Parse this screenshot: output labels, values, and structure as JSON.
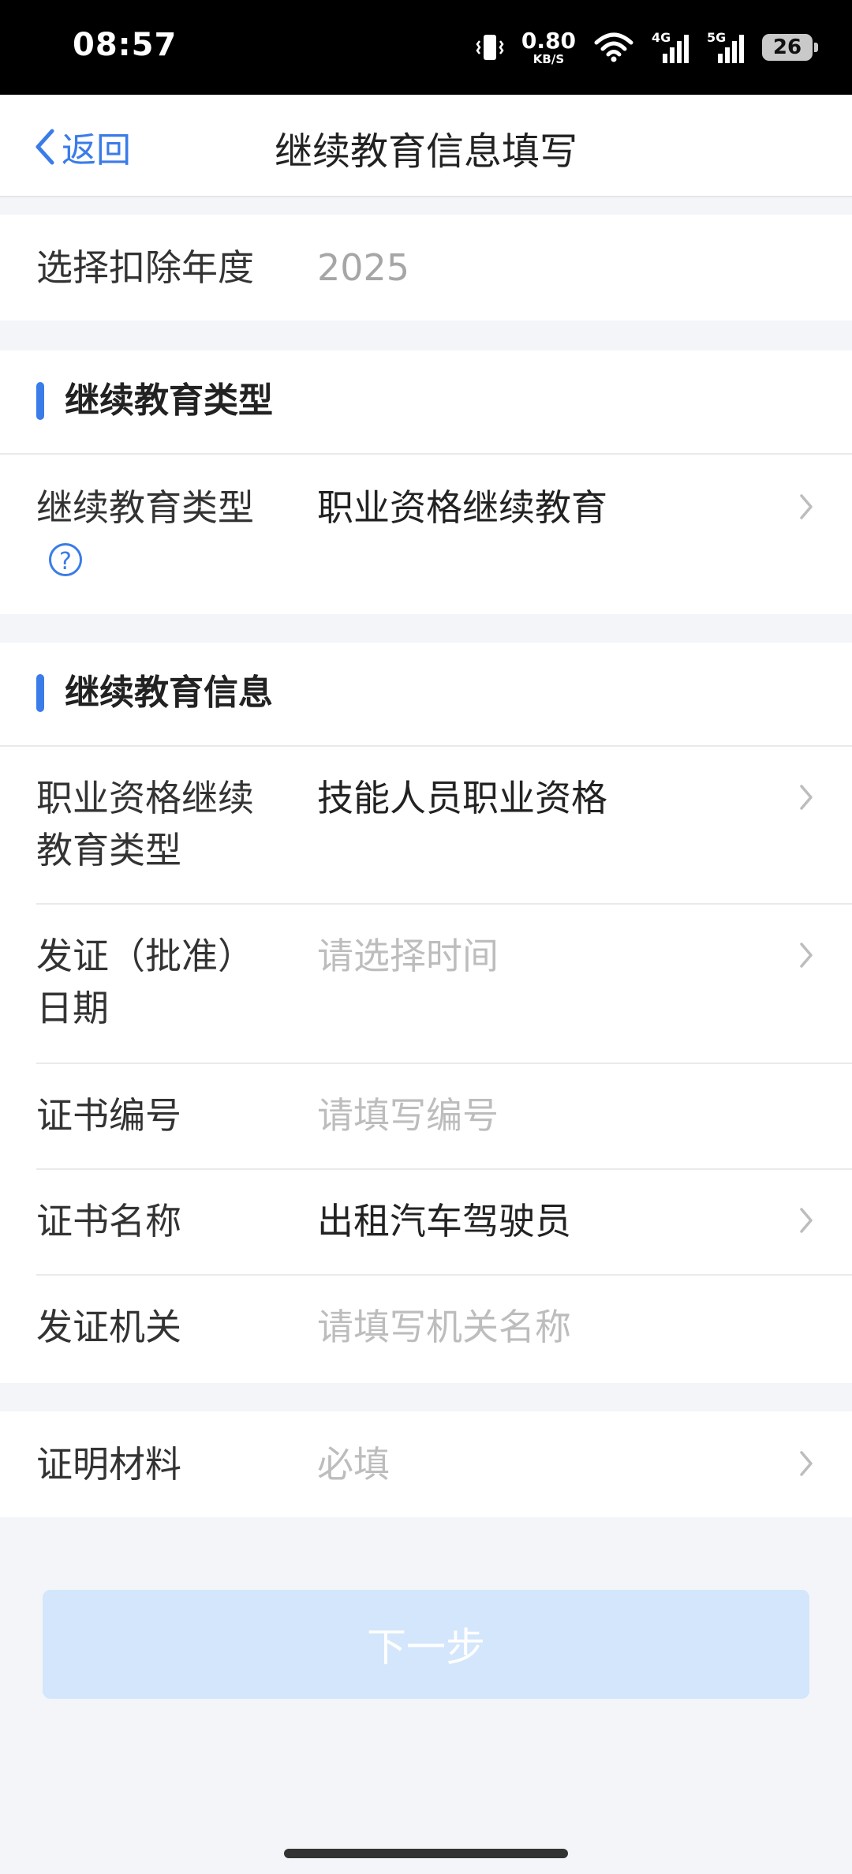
{
  "status": {
    "time": "08:57",
    "speed_value": "0.80",
    "speed_unit": "KB/S",
    "net1": "4G",
    "net2": "5G",
    "battery": "26"
  },
  "nav": {
    "back_label": "返回",
    "title": "继续教育信息填写"
  },
  "year": {
    "label": "选择扣除年度",
    "value": "2025"
  },
  "type_section": {
    "title": "继续教育类型",
    "field_label": "继续教育类型",
    "field_value": "职业资格继续教育",
    "help_glyph": "?"
  },
  "info_section": {
    "title": "继续教育信息",
    "fields": [
      {
        "label_line1": "职业资格继续",
        "label_line2": "教育类型",
        "value": "技能人员职业资格"
      },
      {
        "label_line1": "发证（批准）",
        "label_line2": "日期",
        "placeholder": "请选择时间"
      },
      {
        "label": "证书编号",
        "placeholder": "请填写编号"
      },
      {
        "label": "证书名称",
        "value": "出租汽车驾驶员"
      },
      {
        "label": "发证机关",
        "placeholder": "请填写机关名称"
      }
    ]
  },
  "proof": {
    "label": "证明材料",
    "placeholder": "必填"
  },
  "next_button": "下一步",
  "colors": {
    "accent": "#3a7ce8",
    "button_disabled_bg": "#d3e6fb",
    "page_bg": "#f3f5f9"
  }
}
